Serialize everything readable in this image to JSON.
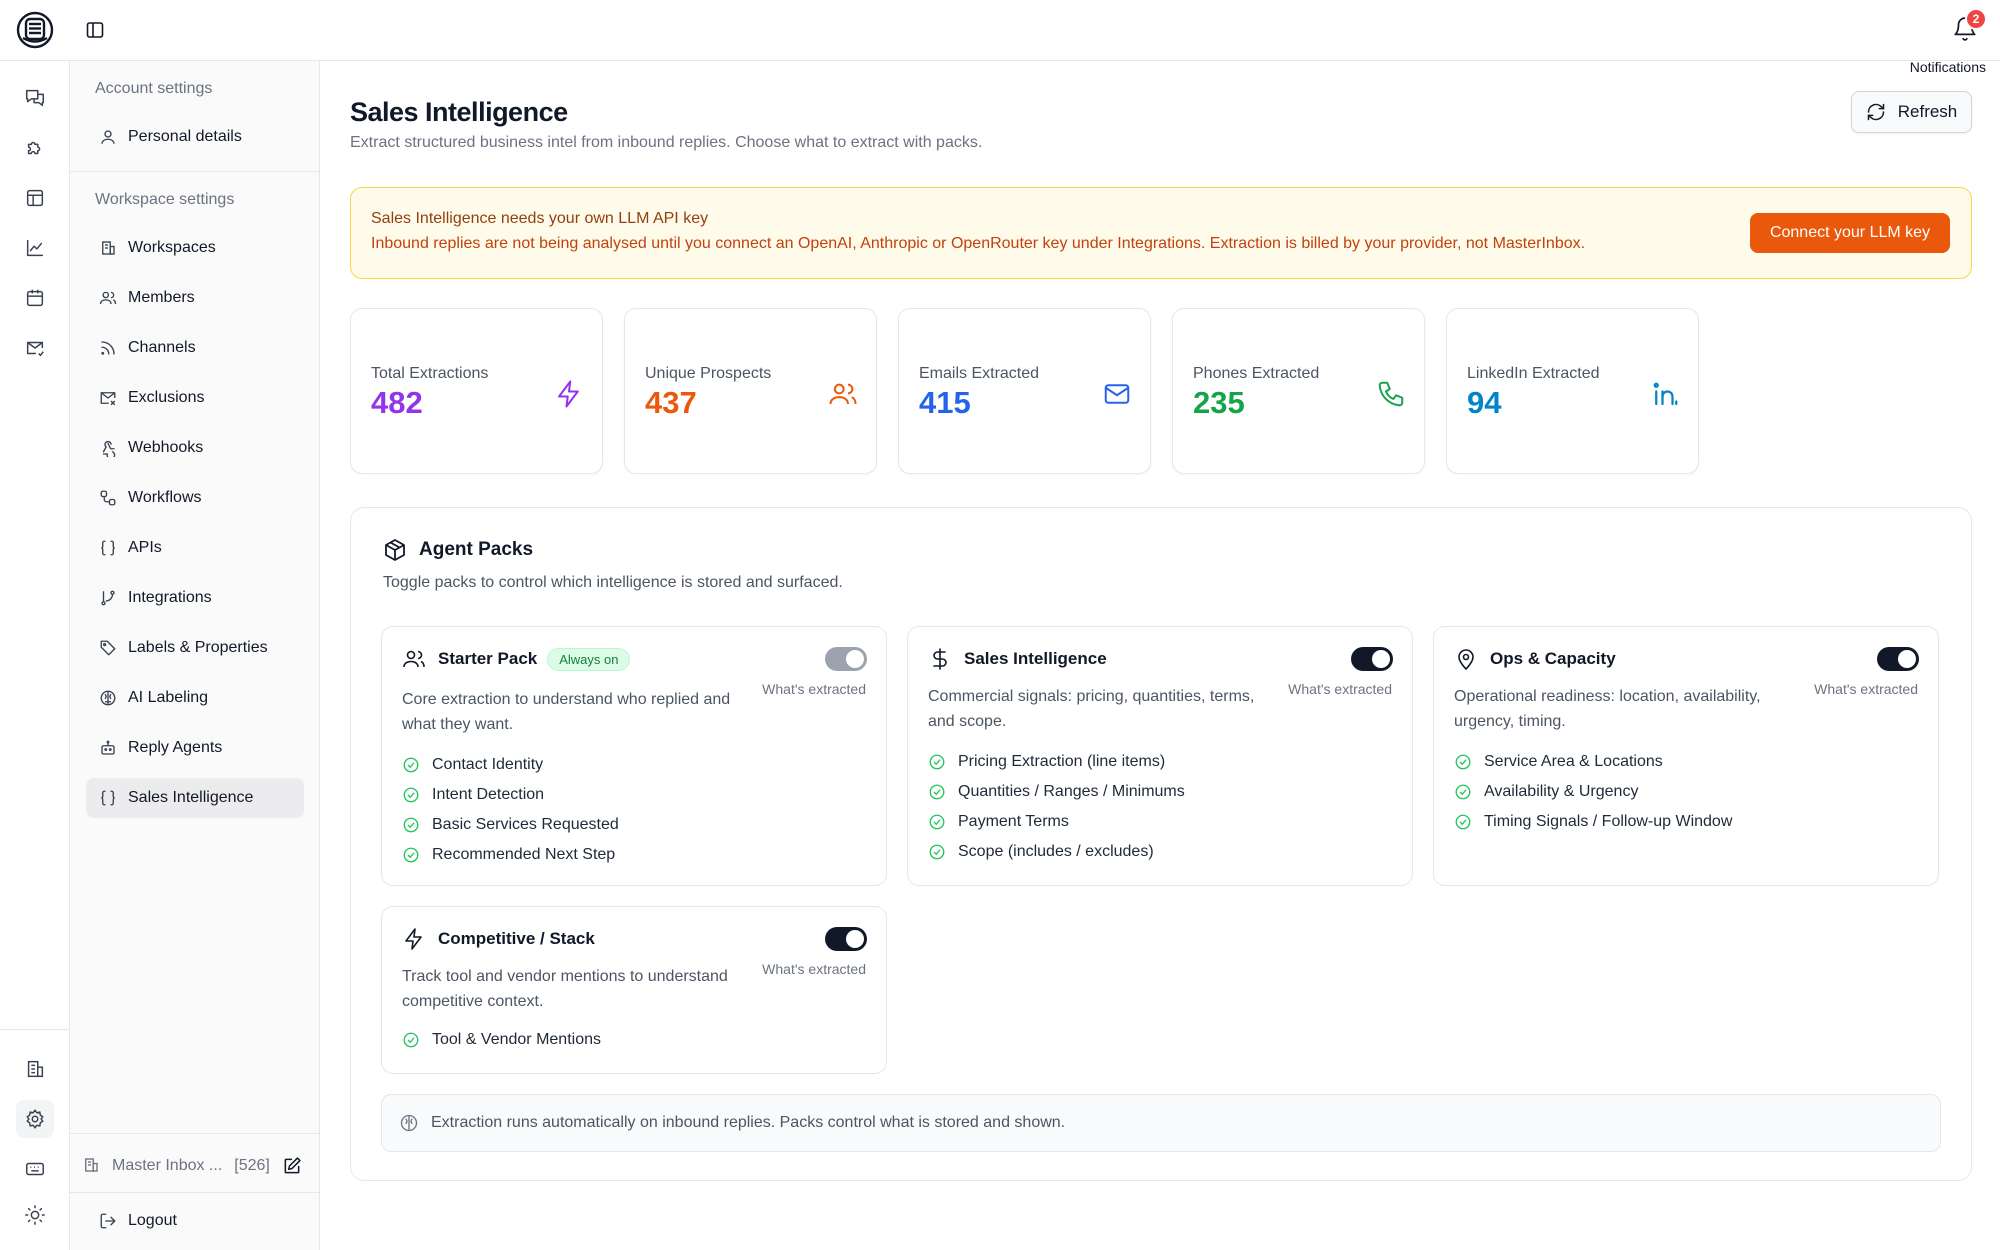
{
  "header": {
    "notifications_label": "Notifications",
    "notifications_count": "2"
  },
  "sidebar": {
    "account_section": "Account settings",
    "account_items": [
      {
        "label": "Personal details",
        "icon": "user-icon"
      }
    ],
    "workspace_section": "Workspace settings",
    "workspace_items": [
      {
        "label": "Workspaces",
        "icon": "building-icon"
      },
      {
        "label": "Members",
        "icon": "users-icon"
      },
      {
        "label": "Channels",
        "icon": "rss-icon"
      },
      {
        "label": "Exclusions",
        "icon": "mail-x-icon"
      },
      {
        "label": "Webhooks",
        "icon": "webhook-icon"
      },
      {
        "label": "Workflows",
        "icon": "workflow-icon"
      },
      {
        "label": "APIs",
        "icon": "braces-icon"
      },
      {
        "label": "Integrations",
        "icon": "git-branch-icon"
      },
      {
        "label": "Labels & Properties",
        "icon": "tag-icon"
      },
      {
        "label": "AI Labeling",
        "icon": "ai-brain-icon"
      },
      {
        "label": "Reply Agents",
        "icon": "bot-icon"
      },
      {
        "label": "Sales Intelligence",
        "icon": "braces-icon",
        "active": true
      }
    ],
    "footer": {
      "workspace_name": "Master Inbox ...",
      "count": "[526]"
    },
    "logout": "Logout"
  },
  "main": {
    "title": "Sales Intelligence",
    "subtitle": "Extract structured business intel from inbound replies. Choose what to extract with packs.",
    "refresh_label": "Refresh",
    "alert": {
      "title": "Sales Intelligence needs your own LLM API key",
      "text": "Inbound replies are not being analysed until you connect an OpenAI, Anthropic or OpenRouter key under Integrations. Extraction is billed by your provider, not MasterInbox.",
      "button": "Connect your LLM key"
    },
    "stats": [
      {
        "label": "Total Extractions",
        "value": "482",
        "color": "#9333ea",
        "icon": "zap-icon"
      },
      {
        "label": "Unique Prospects",
        "value": "437",
        "color": "#ea580c",
        "icon": "users-icon"
      },
      {
        "label": "Emails Extracted",
        "value": "415",
        "color": "#2563eb",
        "icon": "mail-icon"
      },
      {
        "label": "Phones Extracted",
        "value": "235",
        "color": "#16a34a",
        "icon": "phone-icon"
      },
      {
        "label": "LinkedIn Extracted",
        "value": "94",
        "color": "#0284c7",
        "icon": "linkedin-icon"
      }
    ],
    "packs": {
      "title": "Agent Packs",
      "subtitle": "Toggle packs to control which intelligence is stored and surfaced.",
      "whats_extracted": "What's extracted",
      "cards": [
        {
          "name": "Starter Pack",
          "badge": "Always on",
          "enabled": true,
          "locked": true,
          "icon": "users-icon",
          "desc": "Core extraction to understand who replied and what they want.",
          "items": [
            "Contact Identity",
            "Intent Detection",
            "Basic Services Requested",
            "Recommended Next Step"
          ]
        },
        {
          "name": "Sales Intelligence",
          "enabled": true,
          "icon": "dollar-icon",
          "desc": "Commercial signals: pricing, quantities, terms, and scope.",
          "items": [
            "Pricing Extraction (line items)",
            "Quantities / Ranges / Minimums",
            "Payment Terms",
            "Scope (includes / excludes)"
          ]
        },
        {
          "name": "Ops & Capacity",
          "enabled": true,
          "icon": "map-pin-icon",
          "desc": "Operational readiness: location, availability, urgency, timing.",
          "items": [
            "Service Area & Locations",
            "Availability & Urgency",
            "Timing Signals / Follow-up Window"
          ]
        },
        {
          "name": "Competitive / Stack",
          "enabled": true,
          "icon": "zap-icon",
          "desc": "Track tool and vendor mentions to understand competitive context.",
          "items": [
            "Tool & Vendor Mentions"
          ]
        }
      ],
      "footnote": "Extraction runs automatically on inbound replies. Packs control what is stored and shown."
    }
  }
}
